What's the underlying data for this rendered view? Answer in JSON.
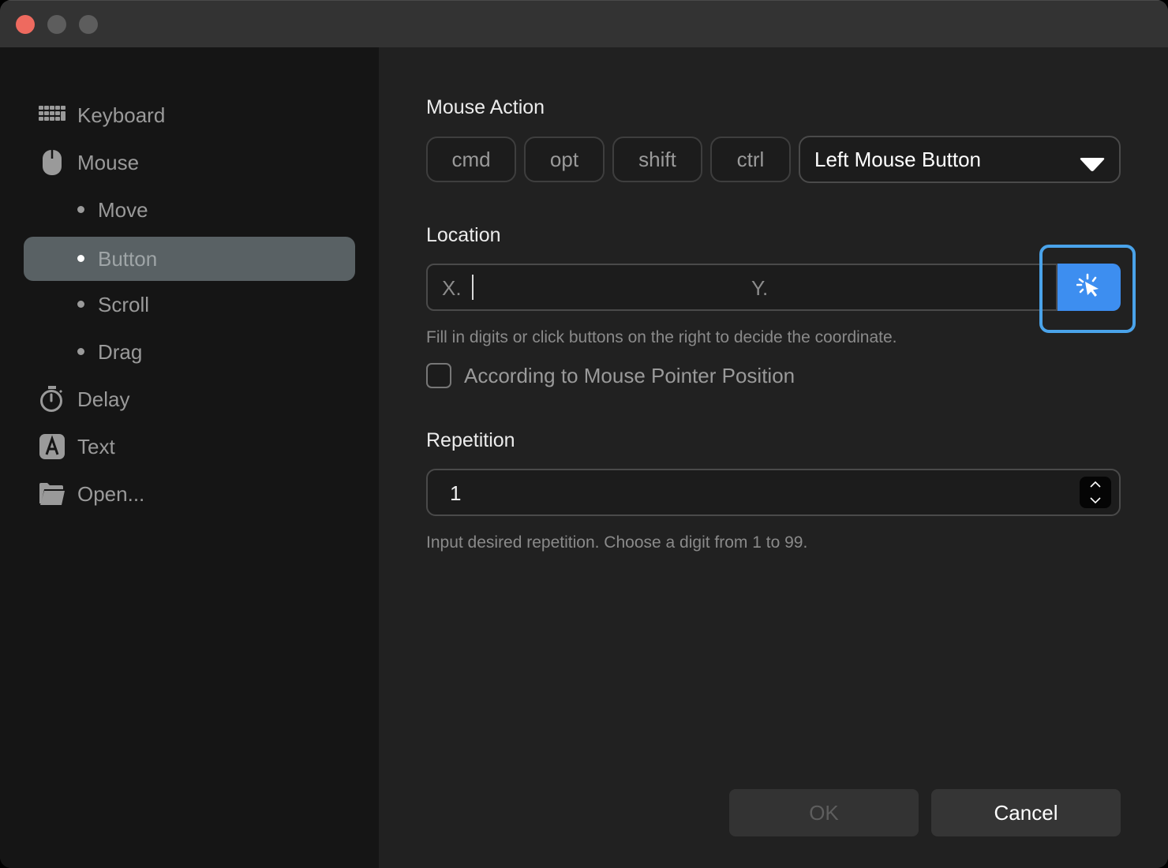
{
  "window": {
    "controls": [
      "close",
      "minimize",
      "maximize"
    ]
  },
  "sidebar": {
    "items": [
      {
        "label": "Keyboard",
        "icon": "keyboard-icon",
        "level": 0
      },
      {
        "label": "Mouse",
        "icon": "mouse-icon",
        "level": 0
      },
      {
        "label": "Move",
        "level": 1
      },
      {
        "label": "Button",
        "level": 1,
        "active": true
      },
      {
        "label": "Scroll",
        "level": 1
      },
      {
        "label": "Drag",
        "level": 1
      },
      {
        "label": "Delay",
        "icon": "stopwatch-icon",
        "level": 0
      },
      {
        "label": "Text",
        "icon": "text-a-icon",
        "level": 0
      },
      {
        "label": "Open...",
        "icon": "folder-icon",
        "level": 0
      }
    ]
  },
  "mouse_action": {
    "title": "Mouse Action",
    "modifiers": [
      "cmd",
      "opt",
      "shift",
      "ctrl"
    ],
    "button_select": {
      "value": "Left Mouse Button"
    }
  },
  "location": {
    "title": "Location",
    "x_label": "X.",
    "x_value": "",
    "y_label": "Y.",
    "y_value": "",
    "pick_button": "pick-location-icon",
    "hint": "Fill in digits or click buttons on the right to decide the coordinate.",
    "pointer_checkbox": {
      "label": "According to Mouse Pointer Position",
      "checked": false
    }
  },
  "repetition": {
    "title": "Repetition",
    "value": "1",
    "hint": "Input desired repetition. Choose a digit from 1 to 99."
  },
  "footer": {
    "ok_label": "OK",
    "cancel_label": "Cancel"
  },
  "colors": {
    "accent": "#3d8ef0",
    "focus_ring": "#4aa3ea",
    "close_button": "#ee6a5f",
    "sidebar_active": "#596164"
  }
}
